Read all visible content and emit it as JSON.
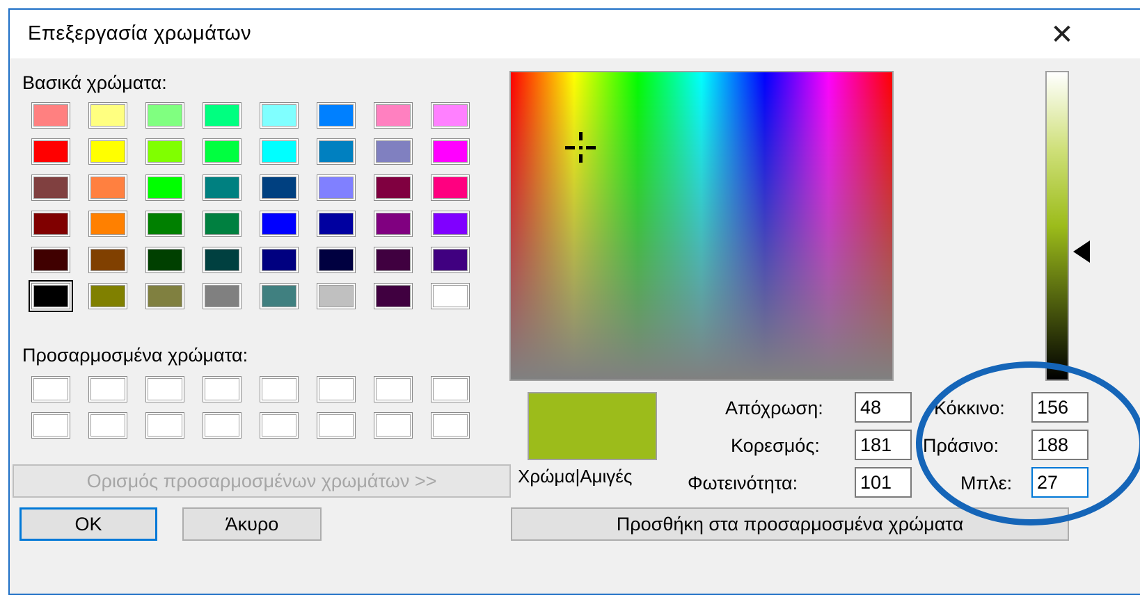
{
  "dialog": {
    "title": "Επεξεργασία χρωμάτων",
    "close_glyph": "✕"
  },
  "basic_colors": {
    "label": "Βασικά χρώματα:",
    "rows": [
      [
        "#ff8080",
        "#ffff80",
        "#80ff80",
        "#00ff80",
        "#80ffff",
        "#0080ff",
        "#ff80c0",
        "#ff80ff"
      ],
      [
        "#ff0000",
        "#ffff00",
        "#80ff00",
        "#00ff40",
        "#00ffff",
        "#0080c0",
        "#8080c0",
        "#ff00ff"
      ],
      [
        "#804040",
        "#ff8040",
        "#00ff00",
        "#008080",
        "#004080",
        "#8080ff",
        "#800040",
        "#ff0080"
      ],
      [
        "#800000",
        "#ff8000",
        "#008000",
        "#008040",
        "#0000ff",
        "#0000a0",
        "#800080",
        "#8000ff"
      ],
      [
        "#400000",
        "#804000",
        "#004000",
        "#004040",
        "#000080",
        "#000040",
        "#400040",
        "#400080"
      ],
      [
        "#000000",
        "#808000",
        "#808040",
        "#808080",
        "#408080",
        "#c0c0c0",
        "#400040",
        "#ffffff"
      ]
    ],
    "selected_row": 5,
    "selected_col": 0
  },
  "custom_colors": {
    "label": "Προσαρμοσμένα χρώματα:"
  },
  "buttons": {
    "define_custom": "Ορισμός προσαρμοσμένων χρωμάτων >>",
    "ok": "OK",
    "cancel": "Άκυρο",
    "add_custom": "Προσθήκη στα προσαρμοσμένα χρώματα"
  },
  "preview": {
    "label": "Χρώμα|Αμιγές",
    "color": "#9cbc1b"
  },
  "hsl": {
    "hue_label": "Απόχρωση:",
    "hue": "48",
    "sat_label": "Κορεσμός:",
    "sat": "181",
    "lum_label": "Φωτεινότητα:",
    "lum": "101"
  },
  "rgb": {
    "red_label": "Κόκκινο:",
    "red": "156",
    "green_label": "Πράσινο:",
    "green": "188",
    "blue_label": "Μπλε:",
    "blue": "27"
  },
  "colors": {
    "accent": "#0078d7",
    "annotation_ring": "#1565b8"
  }
}
